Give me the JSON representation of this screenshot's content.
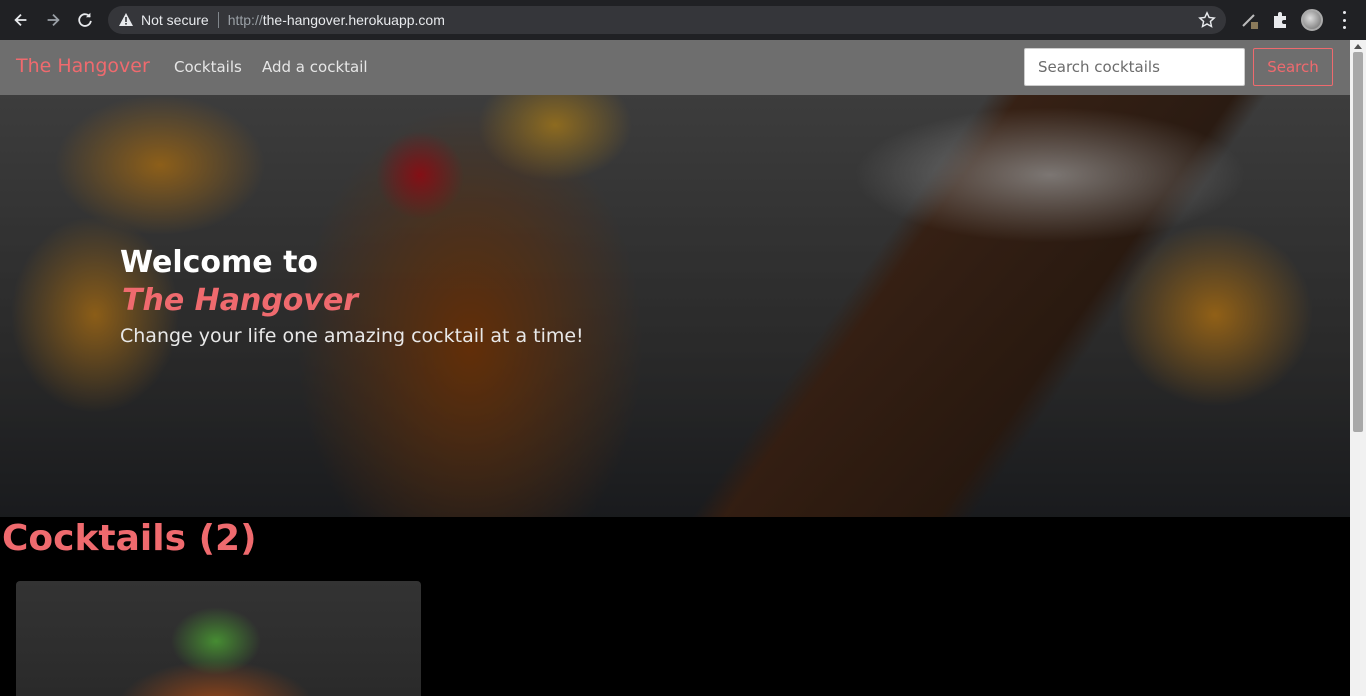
{
  "browser": {
    "security_label": "Not secure",
    "url_scheme": "http://",
    "url_host": "the-hangover.herokuapp.com"
  },
  "nav": {
    "brand": "The Hangover",
    "links": [
      "Cocktails",
      "Add a cocktail"
    ],
    "search_placeholder": "Search cocktails",
    "search_button": "Search"
  },
  "hero": {
    "title": "Welcome to",
    "brand": "The Hangover",
    "tagline": "Change your life one amazing cocktail at a time!"
  },
  "cocktails": {
    "heading": "Cocktails (2)"
  },
  "colors": {
    "accent": "#ef6a6e",
    "navbar": "#6e6e6e",
    "background": "#000000"
  }
}
